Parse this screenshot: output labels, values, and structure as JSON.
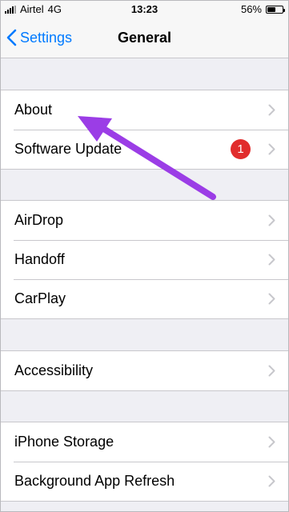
{
  "status_bar": {
    "carrier": "Airtel",
    "network": "4G",
    "time": "13:23",
    "battery_percent_label": "56%",
    "battery_level": 0.56
  },
  "nav": {
    "back_label": "Settings",
    "title": "General"
  },
  "groups": [
    {
      "rows": [
        {
          "label": "About"
        },
        {
          "label": "Software Update",
          "badge": "1"
        }
      ]
    },
    {
      "rows": [
        {
          "label": "AirDrop"
        },
        {
          "label": "Handoff"
        },
        {
          "label": "CarPlay"
        }
      ]
    },
    {
      "rows": [
        {
          "label": "Accessibility"
        }
      ]
    },
    {
      "rows": [
        {
          "label": "iPhone Storage"
        },
        {
          "label": "Background App Refresh"
        }
      ]
    }
  ],
  "colors": {
    "accent": "#007aff",
    "badge": "#e12c2c",
    "annotation_arrow": "#9b3de6",
    "background": "#efeff4"
  },
  "icons": {
    "back": "chevron-left-icon",
    "row": "chevron-right-icon"
  }
}
